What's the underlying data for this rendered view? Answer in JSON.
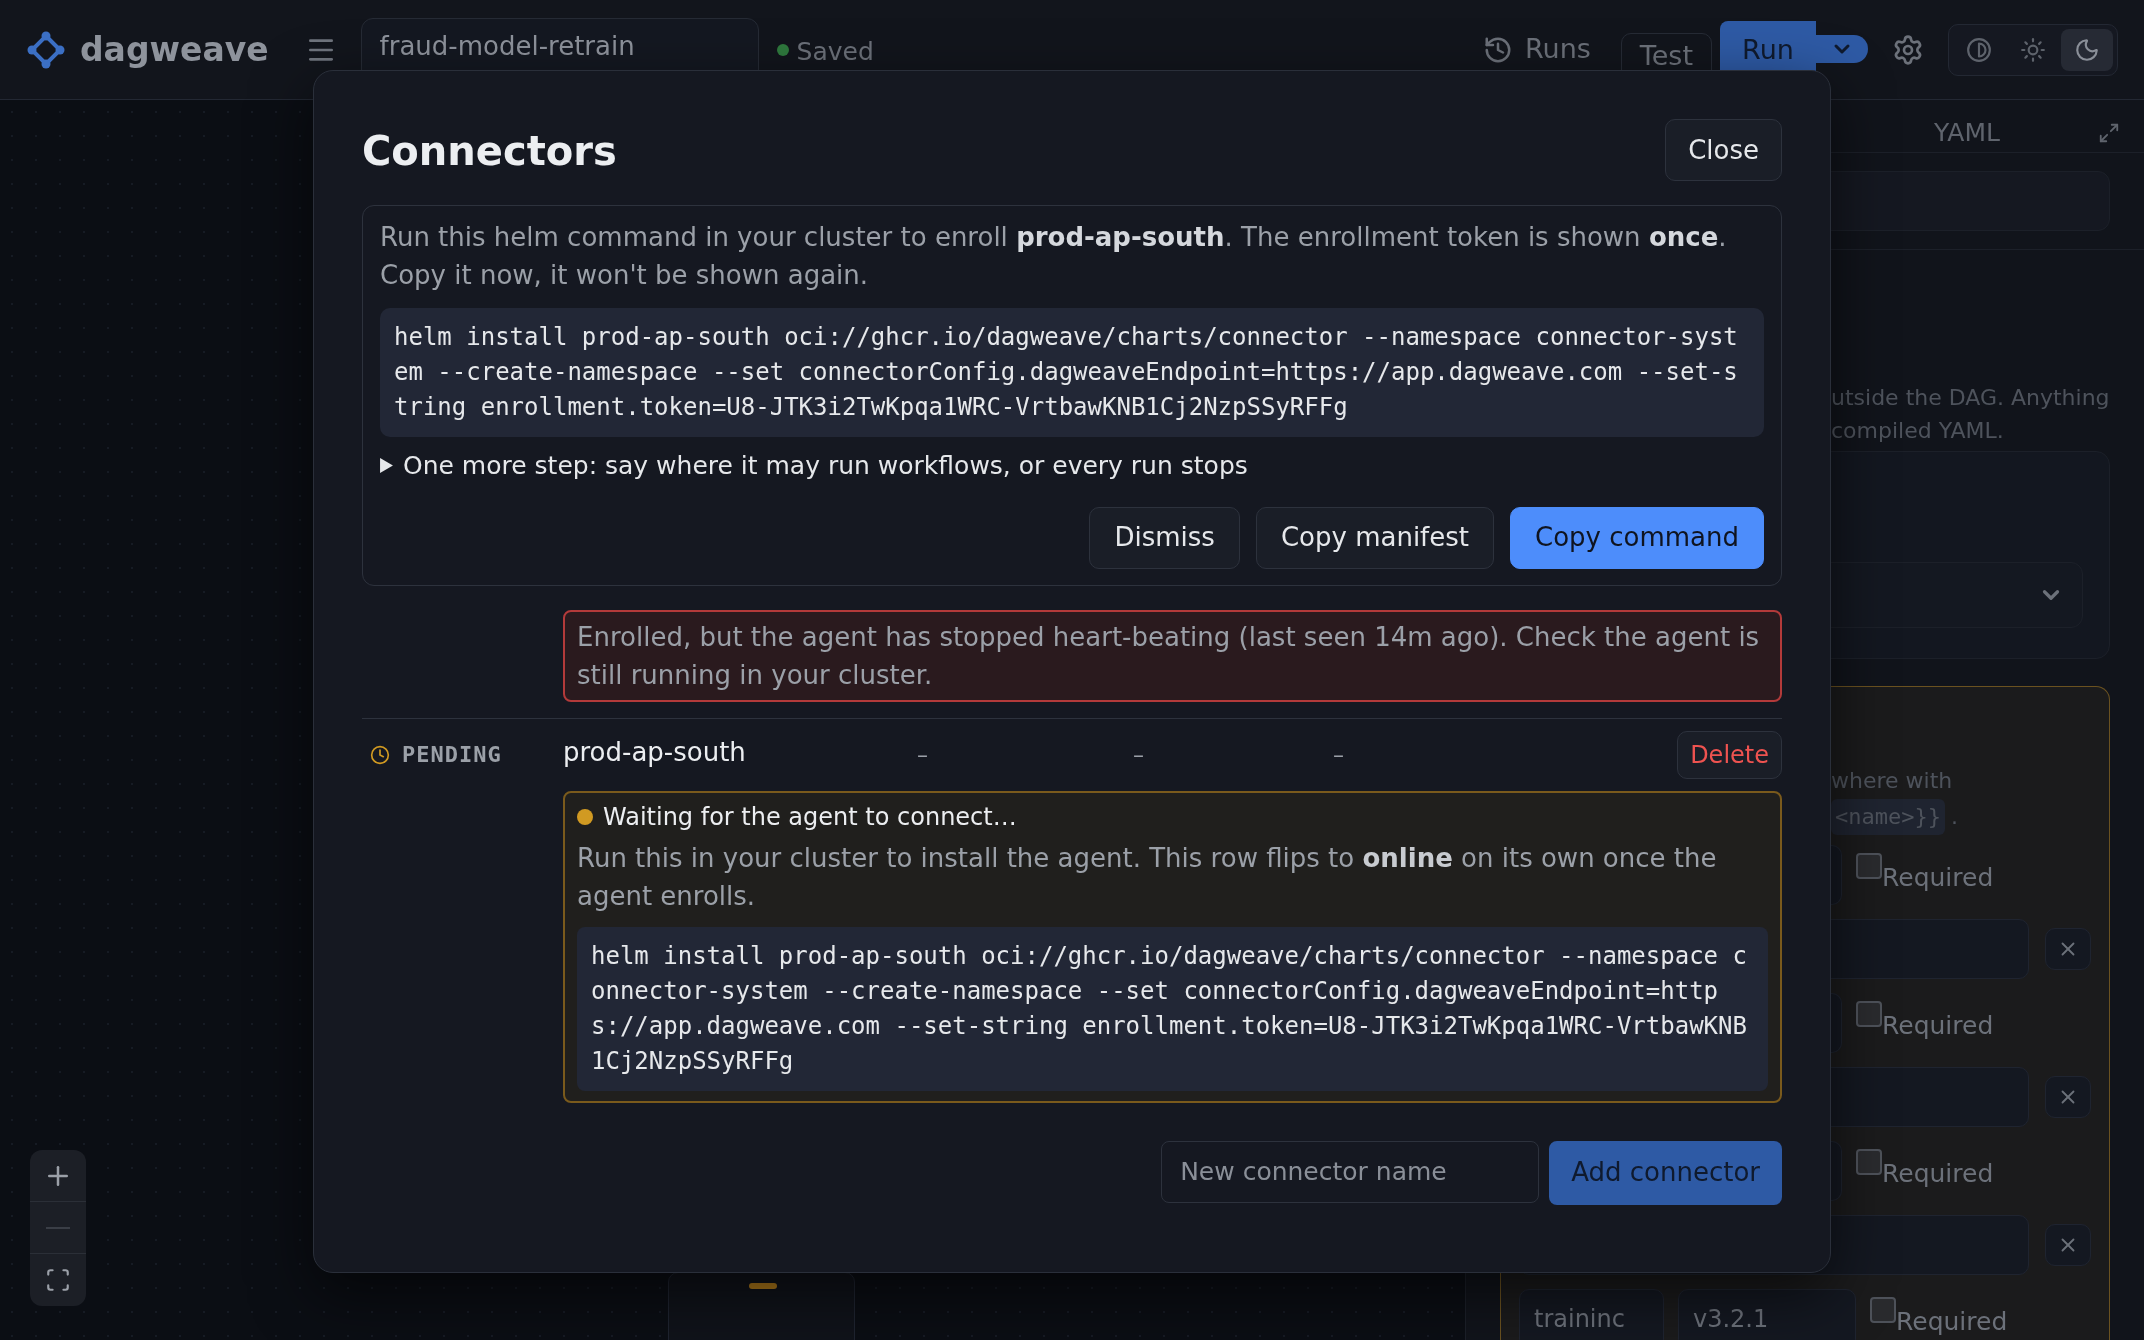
{
  "header": {
    "logo": "dagweave",
    "workflow_name": "fraud-model-retrain",
    "save_status": "Saved",
    "runs": "Runs",
    "test": "Test",
    "run": "Run",
    "theme_options": [
      {
        "kind": "contrast",
        "selected": false
      },
      {
        "kind": "light",
        "selected": false
      },
      {
        "kind": "dark",
        "selected": true
      }
    ]
  },
  "side_panel": {
    "tab": "YAML",
    "description_lines": [
      "utside the DAG. Anything",
      "compiled YAML."
    ],
    "hint_text": "where with",
    "hint_code": "<name>}}",
    "hint_end": ".",
    "param_rows": [
      {
        "label": "Required",
        "required": false
      },
      {
        "label": "Required",
        "required": false
      },
      {
        "label": "Required",
        "required": false
      },
      {
        "name": "traininc",
        "value": "v3.2.1",
        "label": "Required",
        "required": false
      }
    ]
  },
  "modal": {
    "title": "Connectors",
    "close": "Close",
    "enrollment": {
      "message": "Run this helm command in your cluster to enroll **prod-ap-south**. The enrollment token is shown **once**. Copy it now, it won't be shown again.",
      "command": "helm install prod-ap-south oci://ghcr.io/dagweave/charts/connector --namespace connector-system --create-namespace --set connectorConfig.dagweaveEndpoint=https://app.dagweave.com --set-string enrollment.token=U8-JTK3i2TwKpqa1WRC-VrtbawKNB1Cj2NzpSSyRFFg",
      "disclosure": {
        "label": "One more step: say where it may run workflows, or every run stops",
        "expanded": false
      },
      "buttons": [
        {
          "label": "Dismiss",
          "kind": "secondary"
        },
        {
          "label": "Copy manifest",
          "kind": "secondary"
        },
        {
          "label": "Copy command",
          "kind": "primary"
        }
      ]
    },
    "alert": "Enrolled, but the agent has stopped heart-beating (last seen 14m ago). Check the agent is still running in your cluster.",
    "connectors": [
      {
        "kind": "pending",
        "status_label": "PENDING",
        "name": "prod-ap-south",
        "column_3": "–",
        "column_4": "–",
        "column_5": "–",
        "delete": "Delete",
        "waiting": {
          "title": "Waiting for the agent to connect…",
          "message": "Run this in your cluster to install the agent. This row flips to **online** on its own once the agent enrolls.",
          "command": "helm install prod-ap-south oci://ghcr.io/dagweave/charts/connector --namespace connector-system --create-namespace --set connectorConfig.dagweaveEndpoint=https://app.dagweave.com --set-string enrollment.token=U8-JTK3i2TwKpqa1WRC-VrtbawKNB1Cj2NzpSSyRFFg"
        }
      }
    ],
    "add_form": {
      "placeholder": "New connector name",
      "button": "Add connector"
    }
  }
}
